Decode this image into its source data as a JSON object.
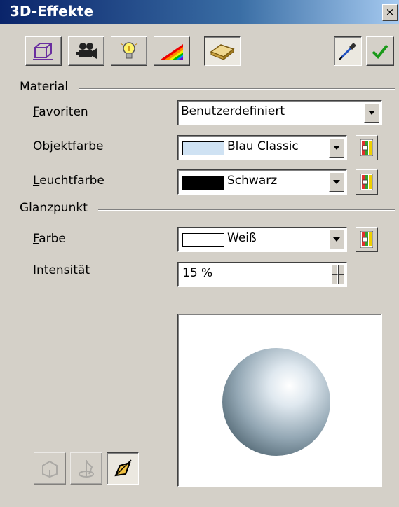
{
  "window": {
    "title": "3D-Effekte",
    "close_glyph": "×"
  },
  "toolbar": {
    "buttons": [
      {
        "name": "geometry-icon"
      },
      {
        "name": "shading-camera-icon"
      },
      {
        "name": "illumination-bulb-icon"
      },
      {
        "name": "textures-rainbow-icon"
      },
      {
        "name": "material-icon",
        "pressed": true
      }
    ],
    "right_buttons": [
      {
        "name": "pipette-icon",
        "pressed": true
      },
      {
        "name": "assign-check-icon"
      }
    ]
  },
  "material": {
    "section_label": "Material",
    "favoriten": {
      "label_ul": "F",
      "label_rest": "avoriten",
      "value": "Benutzerdefiniert"
    },
    "objektfarbe": {
      "label_ul": "O",
      "label_rest": "bjektfarbe",
      "value": "Blau Classic",
      "swatch": "#cfe2f3"
    },
    "leuchtfarbe": {
      "label_ul": "L",
      "label_rest": "euchtfarbe",
      "value": "Schwarz",
      "swatch": "#000000"
    }
  },
  "glanzpunkt": {
    "section_label": "Glanzpunkt",
    "farbe": {
      "label_ul": "F",
      "label_rest": "arbe",
      "value": "Weiß",
      "swatch": "#ffffff"
    },
    "intensitaet": {
      "label_ul": "I",
      "label_rest": "ntensität",
      "value": "15 %"
    }
  },
  "colors": {
    "background": "#d4d0c8",
    "title_start": "#0a246a",
    "title_end": "#a6caf0"
  }
}
